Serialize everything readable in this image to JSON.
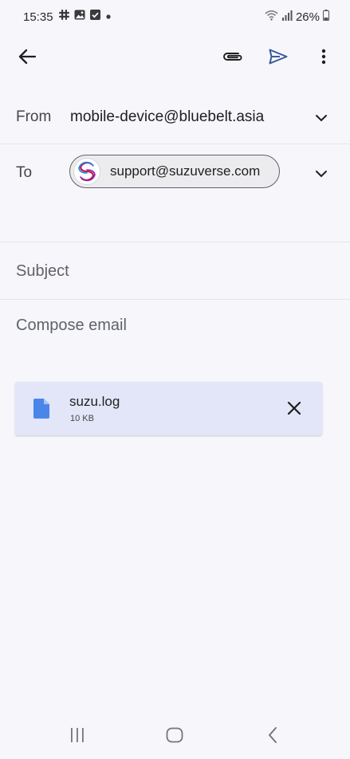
{
  "status_bar": {
    "time": "15:35",
    "battery": "26%",
    "left_icons": [
      "slack-icon",
      "image-icon",
      "checkbox-icon",
      "dot-icon"
    ],
    "right_icons": [
      "wifi-icon",
      "signal-icon",
      "battery-icon"
    ]
  },
  "app_bar": {
    "icons": [
      "back-arrow-icon",
      "paperclip-icon",
      "send-icon",
      "more-vert-icon"
    ],
    "send_color": "#3c5a9a"
  },
  "compose": {
    "from_label": "From",
    "from_value": "mobile-device@bluebelt.asia",
    "to_label": "To",
    "to_chip": "support@suzuverse.com",
    "subject_placeholder": "Subject",
    "body_placeholder": "Compose email"
  },
  "attachment": {
    "file_name": "suzu.log",
    "file_size": "10 KB",
    "icons": [
      "file-icon",
      "close-icon"
    ],
    "accent": "#4a86e8"
  },
  "nav_bar": {
    "icons": [
      "recents-icon",
      "home-icon",
      "back-icon"
    ]
  }
}
